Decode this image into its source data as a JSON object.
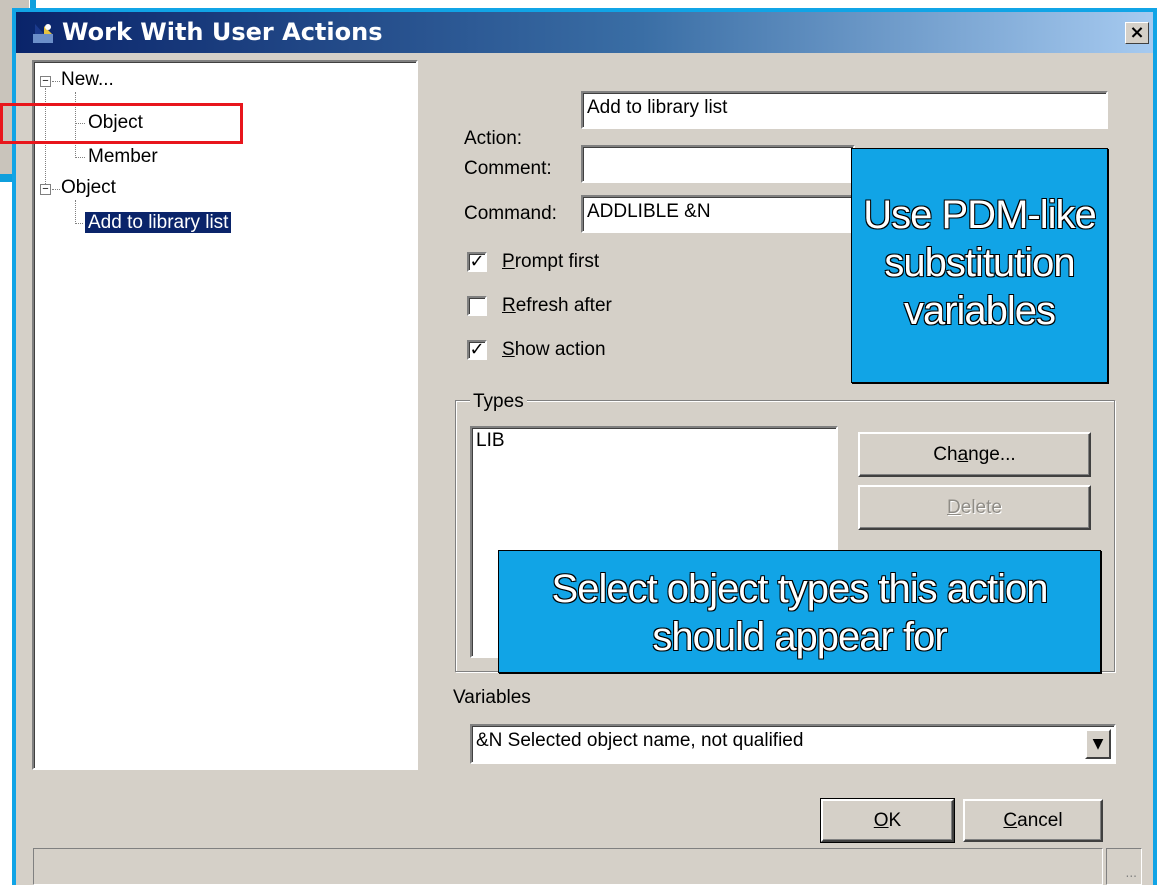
{
  "dialog": {
    "title": "Work With User Actions",
    "close_label": "×"
  },
  "tree": {
    "new_label": "New...",
    "new_object_label": "Object",
    "new_member_label": "Member",
    "object_label": "Object",
    "selected_action_label": "Add to library list",
    "expander_minus": "−"
  },
  "form": {
    "action_label": "Action:",
    "action_value": "Add to library list",
    "comment_label": "Comment:",
    "comment_value": "",
    "command_label": "Command:",
    "command_value": "ADDLIBLE &N",
    "prompt_first": {
      "first_char": "P",
      "rest": "rompt first",
      "checked": true
    },
    "refresh_after": {
      "first_char": "R",
      "rest": "efresh after",
      "checked": false
    },
    "show_action": {
      "first_char": "S",
      "rest": "how action",
      "checked": true
    },
    "check_mark": "✓"
  },
  "types": {
    "legend": "Types",
    "items": [
      "LIB"
    ],
    "change_button": {
      "pre": "Ch",
      "u": "a",
      "post": "nge..."
    },
    "delete_button": {
      "pre": "",
      "u": "D",
      "post": "elete"
    }
  },
  "variables": {
    "label": "Variables",
    "selected": "&N  Selected object name, not qualified",
    "arrow": "▼"
  },
  "buttons": {
    "ok": {
      "u": "O",
      "post": "K"
    },
    "cancel": {
      "u": "C",
      "post": "ancel"
    }
  },
  "statusbar": {
    "grip": "..."
  },
  "callouts": {
    "variables_line1": "Use PDM-like",
    "variables_line2": "substitution",
    "variables_line3": "variables",
    "types_line1": "Select object types this action",
    "types_line2": "should appear for"
  },
  "colors": {
    "slide_blue": "#11a4e6",
    "title_gradient_start": "#0a246a",
    "highlight_red": "#e8161c",
    "dialog_face": "#d5d0c8"
  }
}
